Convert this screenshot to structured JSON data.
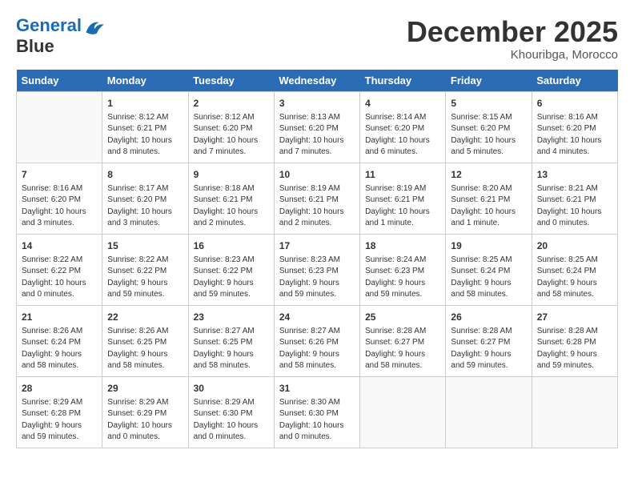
{
  "header": {
    "logo_line1": "General",
    "logo_line2": "Blue",
    "month_title": "December 2025",
    "location": "Khouribga, Morocco"
  },
  "weekdays": [
    "Sunday",
    "Monday",
    "Tuesday",
    "Wednesday",
    "Thursday",
    "Friday",
    "Saturday"
  ],
  "weeks": [
    [
      {
        "day": "",
        "sunrise": "",
        "sunset": "",
        "daylight": ""
      },
      {
        "day": "1",
        "sunrise": "8:12 AM",
        "sunset": "6:21 PM",
        "daylight": "10 hours and 8 minutes."
      },
      {
        "day": "2",
        "sunrise": "8:12 AM",
        "sunset": "6:20 PM",
        "daylight": "10 hours and 7 minutes."
      },
      {
        "day": "3",
        "sunrise": "8:13 AM",
        "sunset": "6:20 PM",
        "daylight": "10 hours and 7 minutes."
      },
      {
        "day": "4",
        "sunrise": "8:14 AM",
        "sunset": "6:20 PM",
        "daylight": "10 hours and 6 minutes."
      },
      {
        "day": "5",
        "sunrise": "8:15 AM",
        "sunset": "6:20 PM",
        "daylight": "10 hours and 5 minutes."
      },
      {
        "day": "6",
        "sunrise": "8:16 AM",
        "sunset": "6:20 PM",
        "daylight": "10 hours and 4 minutes."
      }
    ],
    [
      {
        "day": "7",
        "sunrise": "8:16 AM",
        "sunset": "6:20 PM",
        "daylight": "10 hours and 3 minutes."
      },
      {
        "day": "8",
        "sunrise": "8:17 AM",
        "sunset": "6:20 PM",
        "daylight": "10 hours and 3 minutes."
      },
      {
        "day": "9",
        "sunrise": "8:18 AM",
        "sunset": "6:21 PM",
        "daylight": "10 hours and 2 minutes."
      },
      {
        "day": "10",
        "sunrise": "8:19 AM",
        "sunset": "6:21 PM",
        "daylight": "10 hours and 2 minutes."
      },
      {
        "day": "11",
        "sunrise": "8:19 AM",
        "sunset": "6:21 PM",
        "daylight": "10 hours and 1 minute."
      },
      {
        "day": "12",
        "sunrise": "8:20 AM",
        "sunset": "6:21 PM",
        "daylight": "10 hours and 1 minute."
      },
      {
        "day": "13",
        "sunrise": "8:21 AM",
        "sunset": "6:21 PM",
        "daylight": "10 hours and 0 minutes."
      }
    ],
    [
      {
        "day": "14",
        "sunrise": "8:22 AM",
        "sunset": "6:22 PM",
        "daylight": "10 hours and 0 minutes."
      },
      {
        "day": "15",
        "sunrise": "8:22 AM",
        "sunset": "6:22 PM",
        "daylight": "9 hours and 59 minutes."
      },
      {
        "day": "16",
        "sunrise": "8:23 AM",
        "sunset": "6:22 PM",
        "daylight": "9 hours and 59 minutes."
      },
      {
        "day": "17",
        "sunrise": "8:23 AM",
        "sunset": "6:23 PM",
        "daylight": "9 hours and 59 minutes."
      },
      {
        "day": "18",
        "sunrise": "8:24 AM",
        "sunset": "6:23 PM",
        "daylight": "9 hours and 59 minutes."
      },
      {
        "day": "19",
        "sunrise": "8:25 AM",
        "sunset": "6:24 PM",
        "daylight": "9 hours and 58 minutes."
      },
      {
        "day": "20",
        "sunrise": "8:25 AM",
        "sunset": "6:24 PM",
        "daylight": "9 hours and 58 minutes."
      }
    ],
    [
      {
        "day": "21",
        "sunrise": "8:26 AM",
        "sunset": "6:24 PM",
        "daylight": "9 hours and 58 minutes."
      },
      {
        "day": "22",
        "sunrise": "8:26 AM",
        "sunset": "6:25 PM",
        "daylight": "9 hours and 58 minutes."
      },
      {
        "day": "23",
        "sunrise": "8:27 AM",
        "sunset": "6:25 PM",
        "daylight": "9 hours and 58 minutes."
      },
      {
        "day": "24",
        "sunrise": "8:27 AM",
        "sunset": "6:26 PM",
        "daylight": "9 hours and 58 minutes."
      },
      {
        "day": "25",
        "sunrise": "8:28 AM",
        "sunset": "6:27 PM",
        "daylight": "9 hours and 58 minutes."
      },
      {
        "day": "26",
        "sunrise": "8:28 AM",
        "sunset": "6:27 PM",
        "daylight": "9 hours and 59 minutes."
      },
      {
        "day": "27",
        "sunrise": "8:28 AM",
        "sunset": "6:28 PM",
        "daylight": "9 hours and 59 minutes."
      }
    ],
    [
      {
        "day": "28",
        "sunrise": "8:29 AM",
        "sunset": "6:28 PM",
        "daylight": "9 hours and 59 minutes."
      },
      {
        "day": "29",
        "sunrise": "8:29 AM",
        "sunset": "6:29 PM",
        "daylight": "10 hours and 0 minutes."
      },
      {
        "day": "30",
        "sunrise": "8:29 AM",
        "sunset": "6:30 PM",
        "daylight": "10 hours and 0 minutes."
      },
      {
        "day": "31",
        "sunrise": "8:30 AM",
        "sunset": "6:30 PM",
        "daylight": "10 hours and 0 minutes."
      },
      {
        "day": "",
        "sunrise": "",
        "sunset": "",
        "daylight": ""
      },
      {
        "day": "",
        "sunrise": "",
        "sunset": "",
        "daylight": ""
      },
      {
        "day": "",
        "sunrise": "",
        "sunset": "",
        "daylight": ""
      }
    ]
  ],
  "labels": {
    "sunrise_prefix": "Sunrise: ",
    "sunset_prefix": "Sunset: ",
    "daylight_prefix": "Daylight: "
  }
}
